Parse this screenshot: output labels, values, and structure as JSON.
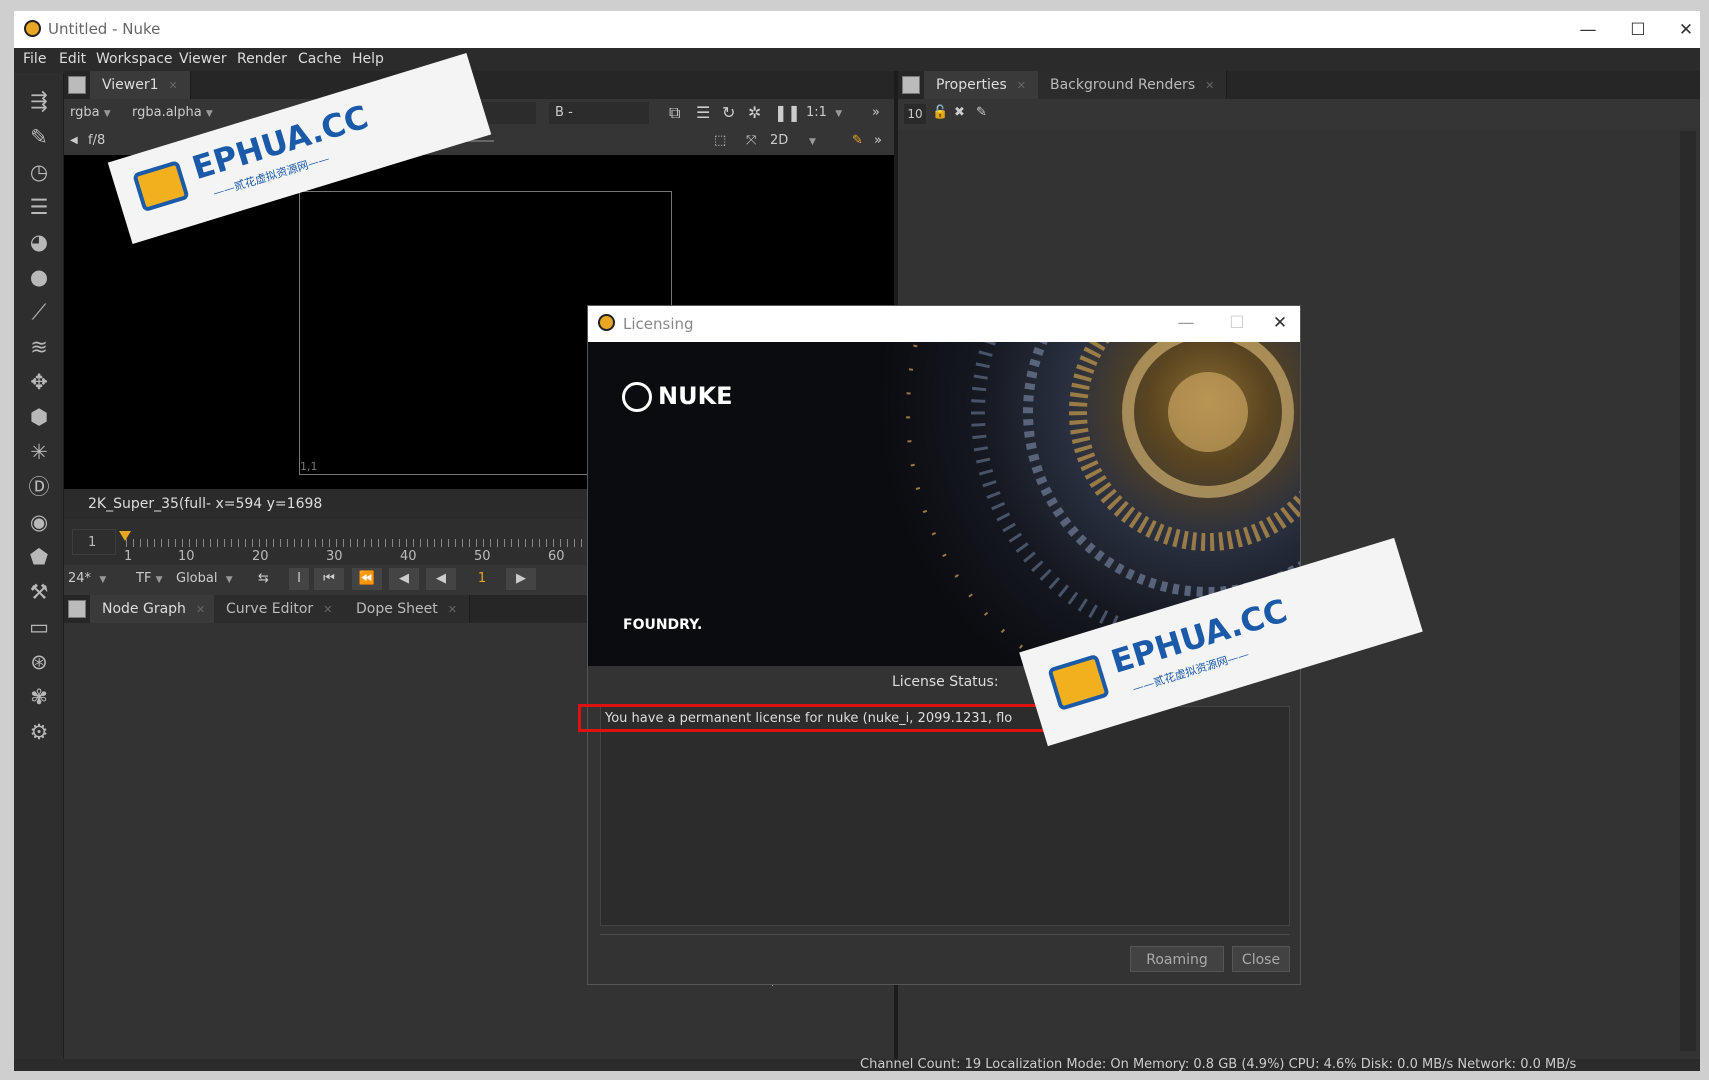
{
  "window": {
    "title": "Untitled - Nuke",
    "minimize": "—",
    "maximize": "☐",
    "close": "✕"
  },
  "menu": [
    "File",
    "Edit",
    "Workspace",
    "Viewer",
    "Render",
    "Cache",
    "Help"
  ],
  "viewer": {
    "tab": "Viewer1",
    "channels": "rgba",
    "alpha": "rgba.alpha",
    "input_b_label": "B",
    "input_b_value": "-",
    "input_a_value": "-",
    "zoom": "1:1",
    "fstop": "f/8",
    "mode": "2D",
    "format_info": "2K_Super_35(full-  x=594 y=1698",
    "corner_label": "1,1"
  },
  "timeline": {
    "start": "1",
    "ticks": [
      "1",
      "10",
      "20",
      "30",
      "40",
      "50",
      "60"
    ],
    "fps": "24*",
    "tf": "TF",
    "global": "Global",
    "current_frame": "1"
  },
  "bottom_tabs": [
    "Node Graph",
    "Curve Editor",
    "Dope Sheet"
  ],
  "properties": {
    "tabs": [
      "Properties",
      "Background Renders"
    ],
    "max_panels": "10"
  },
  "dialog": {
    "title": "Licensing",
    "brand": "NUKE",
    "company": "FOUNDRY.",
    "status_label": "License Status:",
    "status_text": "You have a permanent license for nuke (nuke_i, 2099.1231, flo",
    "roaming": "Roaming",
    "close": "Close"
  },
  "watermark": {
    "text": "EPHUA.CC",
    "subtitle": "——贰花虚拟资源网——"
  },
  "statusbar": "Channel Count: 19  Localization Mode: On  Memory: 0.8 GB (4.9%)  CPU: 4.6%  Disk: 0.0 MB/s  Network: 0.0 MB/s",
  "icons": [
    "nuke-app-icon",
    "properties-panel-icon",
    "layers-icon",
    "clock-icon",
    "settings-icon",
    "draw-icon",
    "color-icon",
    "transform-icon",
    "3d-icon",
    "particles-icon",
    "eye-icon"
  ],
  "colors": {
    "accent_orange": "#e8a624",
    "highlight_red": "#e01010",
    "watermark_blue": "#1a5aa8"
  }
}
